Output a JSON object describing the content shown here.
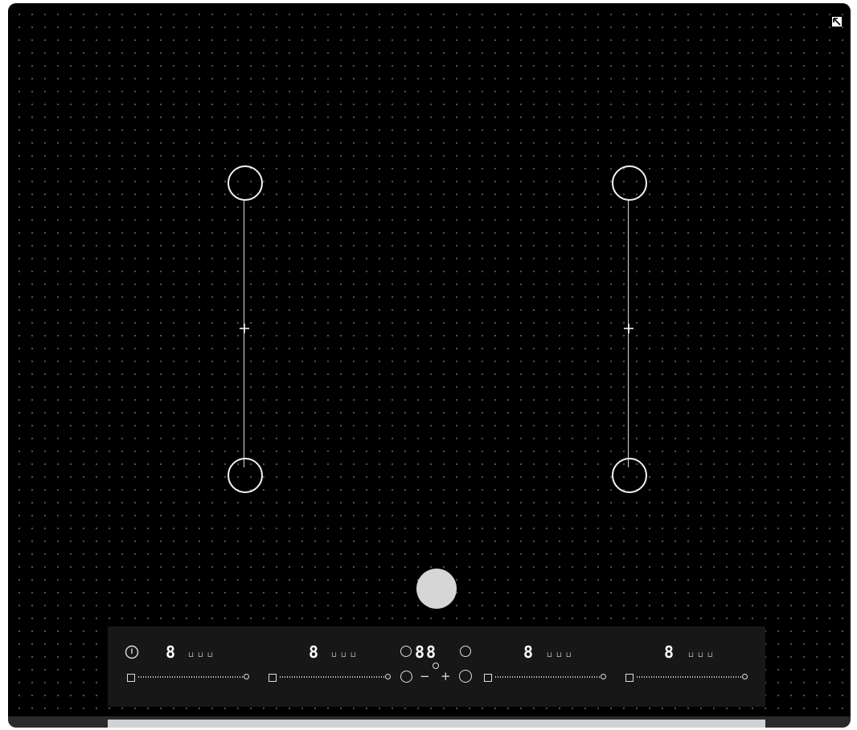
{
  "cooktop": {
    "zones": [
      {
        "id": "left",
        "bridge_icon": "plus"
      },
      {
        "id": "right",
        "bridge_icon": "plus"
      }
    ],
    "center_control": {
      "icon": "filled-circle"
    }
  },
  "control_panel": {
    "zone_displays": [
      {
        "digit": "8",
        "pot_icons": "⊔ ⊔ ⊔"
      },
      {
        "digit": "8",
        "pot_icons": "⊔ ⊔ ⊔"
      },
      {
        "digit": "8",
        "pot_icons": "⊔ ⊔ ⊔"
      },
      {
        "digit": "8",
        "pot_icons": "⊔ ⊔ ⊔"
      }
    ],
    "timer_display": "88",
    "minus_label": "−",
    "plus_label": "+",
    "power_icon": "power-icon"
  },
  "colors": {
    "glass": "#000000",
    "panel": "#171717",
    "knob": "#d6d6d6",
    "frame_light": "#cfd3d6"
  }
}
